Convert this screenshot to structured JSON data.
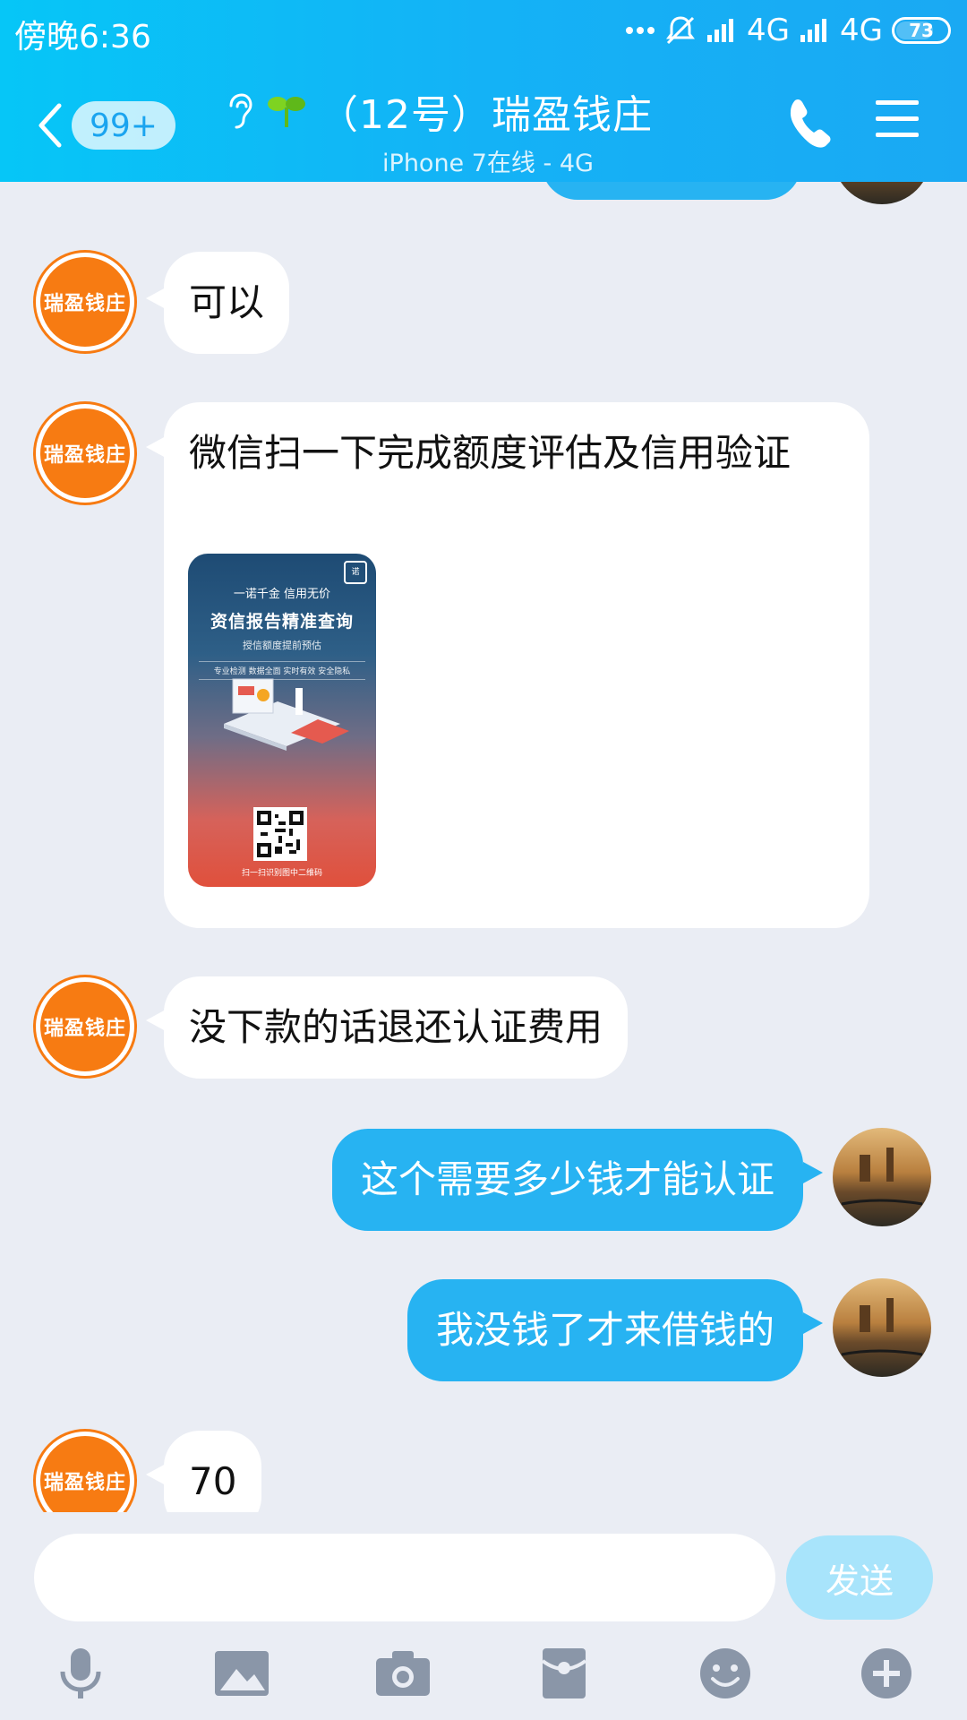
{
  "status_bar": {
    "time": "傍晚6:36",
    "network1": "4G",
    "network2": "4G",
    "battery": "73"
  },
  "header": {
    "unread_count": "99+",
    "title": "（12号）瑞盈钱庄",
    "subtitle": "iPhone 7在线 - 4G"
  },
  "contact": {
    "avatar_text": "瑞盈钱庄"
  },
  "messages": [
    {
      "from": "them",
      "text": "可以"
    },
    {
      "from": "them",
      "text": "微信扫一下完成额度评估及信用验证"
    },
    {
      "from": "them",
      "text": "没下款的话退还认证费用"
    },
    {
      "from": "me",
      "text": "这个需要多少钱才能认证"
    },
    {
      "from": "me",
      "text": "我没钱了才来借钱的"
    },
    {
      "from": "them",
      "text": "70"
    }
  ],
  "qr_image": {
    "line1": "一诺千金 信用无价",
    "line2": "资信报告精准查询",
    "line3": "授信额度提前预估",
    "line4": "专业检测  数据全面  实时有效  安全隐私",
    "line5": "扫一扫识别图中二维码",
    "logo": "诺"
  },
  "input": {
    "placeholder": "",
    "send_label": "发送"
  },
  "toolbar": {
    "icons": [
      "microphone-icon",
      "image-icon",
      "camera-icon",
      "red-packet-icon",
      "emoji-icon",
      "plus-icon"
    ]
  },
  "colors": {
    "header": "#14b2f6",
    "outgoing_bubble": "#27b3f2",
    "avatar_orange": "#f77b12",
    "background": "#eaedf4"
  }
}
